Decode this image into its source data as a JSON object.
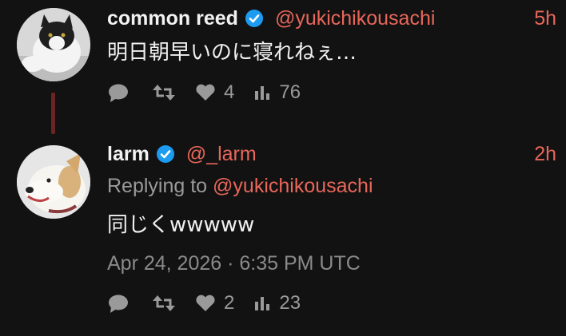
{
  "tweets": [
    {
      "display_name": "common reed",
      "handle": "@yukichikousachi",
      "time": "5h",
      "text": "明日朝早いのに寝れねぇ…",
      "likes": "4",
      "views": "76",
      "avatar": "cat-avatar"
    },
    {
      "display_name": "larm",
      "handle": "@_larm",
      "time": "2h",
      "replying_prefix": "Replying to",
      "replying_handle": "@yukichikousachi",
      "text": "同じくwwwww",
      "timestamp": "Apr 24, 2026 · 6:35 PM UTC",
      "likes": "2",
      "views": "23",
      "avatar": "dog-avatar"
    }
  ],
  "colors": {
    "background": "#121212",
    "accent": "#e8675a",
    "verified": "#1d9bf0",
    "muted": "#9a9a9a",
    "thread_line": "#6b2424"
  },
  "icons": [
    "comment-icon",
    "retweet-icon",
    "heart-icon",
    "views-icon",
    "verified-badge-icon"
  ]
}
